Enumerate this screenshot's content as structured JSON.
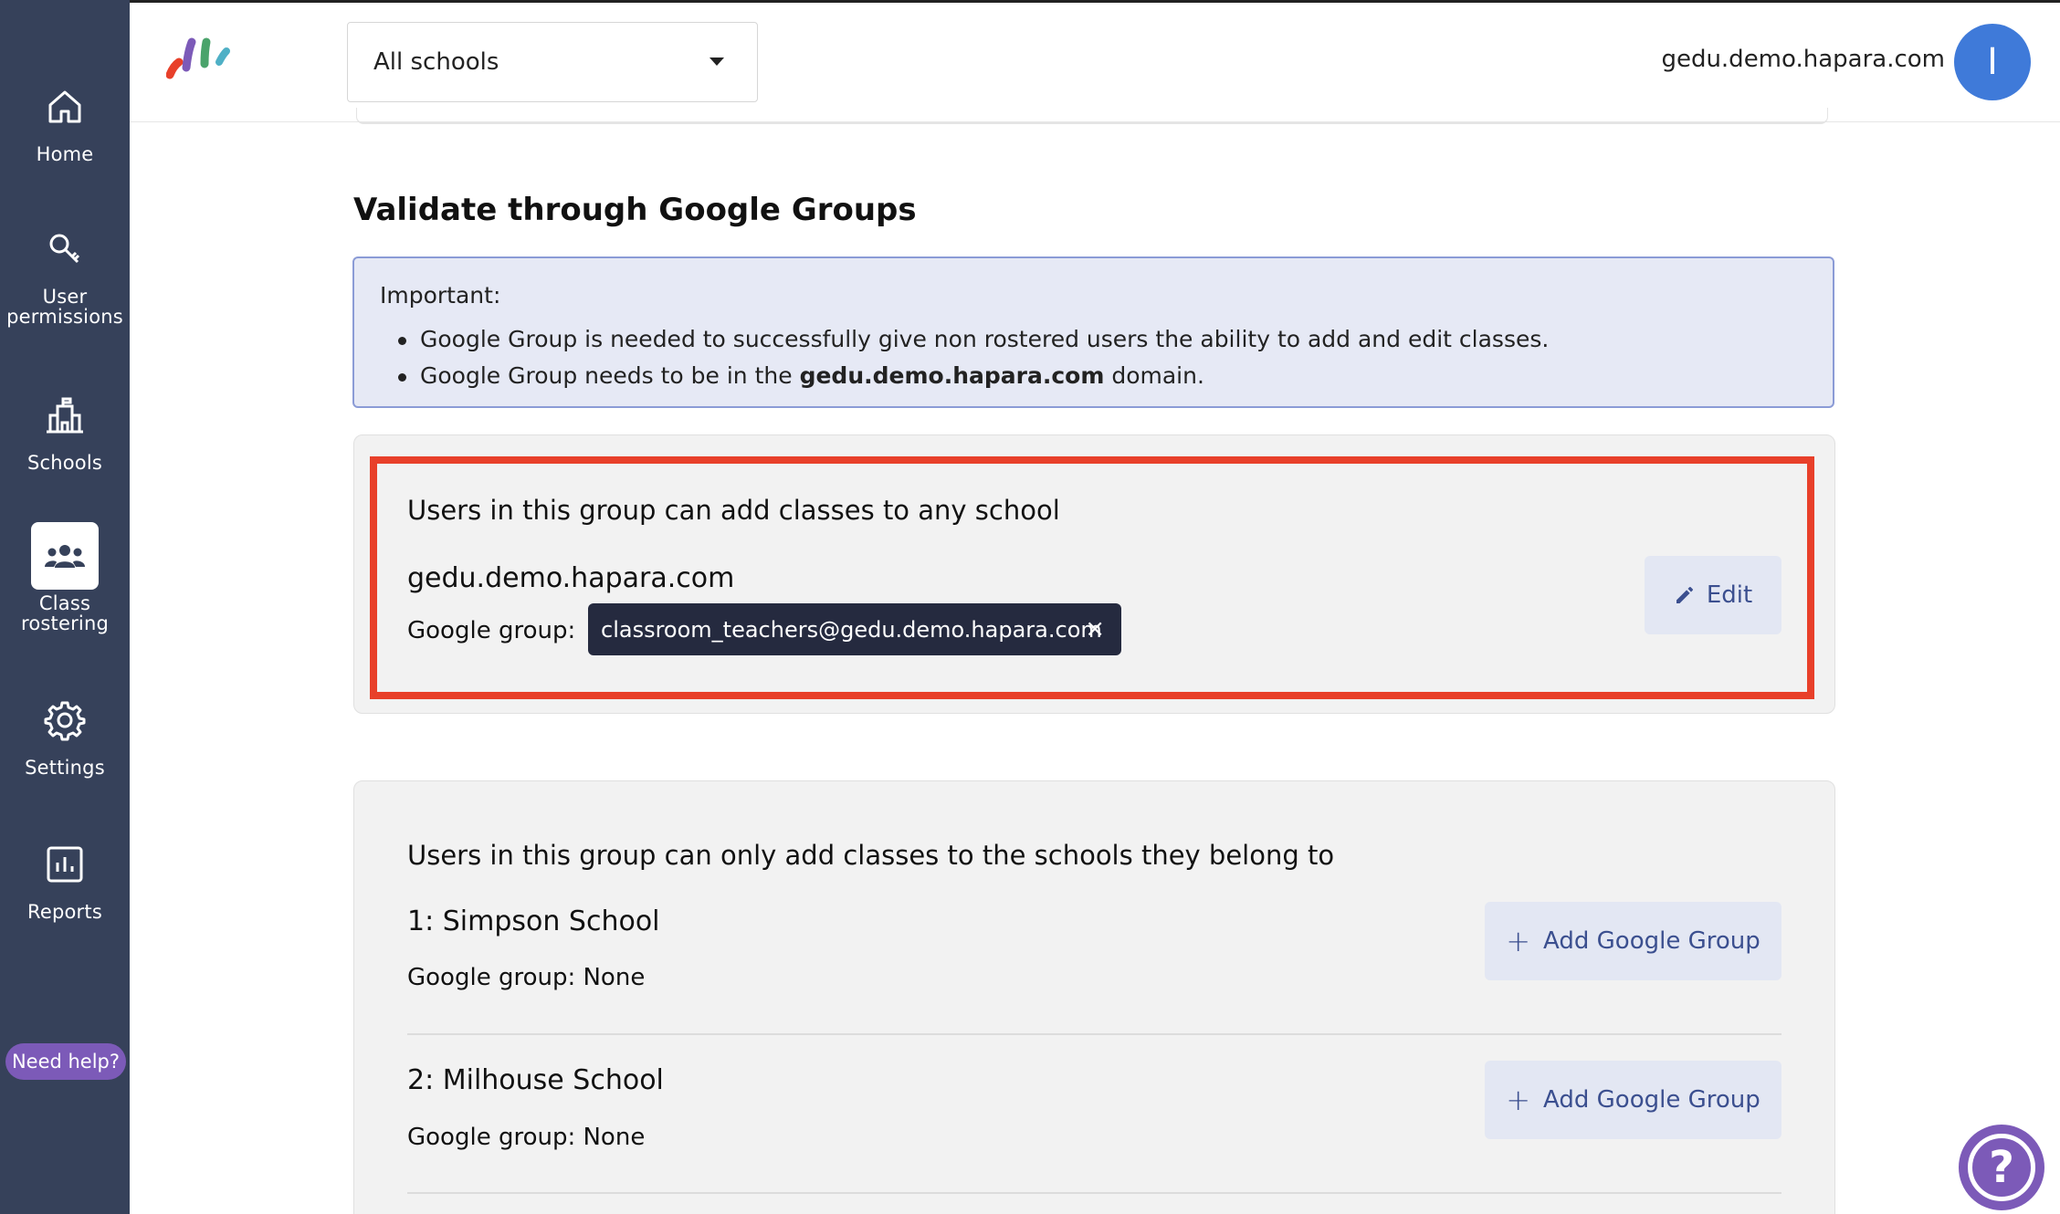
{
  "sidebar": {
    "items": [
      {
        "label": "Home",
        "icon": "home-icon"
      },
      {
        "label": "User\npermissions",
        "icon": "key-icon"
      },
      {
        "label": "Schools",
        "icon": "school-icon"
      },
      {
        "label": "Class\nrostering",
        "icon": "people-icon",
        "active": true
      },
      {
        "label": "Settings",
        "icon": "gear-icon"
      },
      {
        "label": "Reports",
        "icon": "chart-icon"
      }
    ],
    "help_label": "Need help?"
  },
  "header": {
    "school_select_value": "All schools",
    "domain": "gedu.demo.hapara.com",
    "avatar_initial": "I"
  },
  "main": {
    "section_title": "Validate through Google Groups",
    "info": {
      "heading": "Important:",
      "bullet_1": "Google Group is needed to successfully give non rostered users the ability to add and edit classes.",
      "bullet_2_prefix": "Google Group needs to be in the ",
      "bullet_2_bold": "gedu.demo.hapara.com",
      "bullet_2_suffix": " domain."
    },
    "any_school_group": {
      "title": "Users in this group can add classes to any school",
      "domain": "gedu.demo.hapara.com",
      "google_group_label": "Google group:",
      "chip_value": "classroom_teachers@gedu.demo.hapara.com",
      "chip_close": "×",
      "edit_label": "Edit"
    },
    "schools_group": {
      "title": "Users in this group can only add classes to the schools they belong to",
      "schools": [
        {
          "name": "1: Simpson School",
          "google_group": "Google group: None",
          "add_label": "Add Google Group"
        },
        {
          "name": "2: Milhouse School",
          "google_group": "Google group: None",
          "add_label": "Add Google Group"
        }
      ]
    }
  },
  "colors": {
    "sidebar_bg": "#36415a",
    "accent_purple": "#7c5ab8",
    "highlight_red": "#e8402a",
    "avatar_blue": "#3f7ad9",
    "button_text": "#3b4f8f"
  },
  "help_fab_icon": "question-icon"
}
